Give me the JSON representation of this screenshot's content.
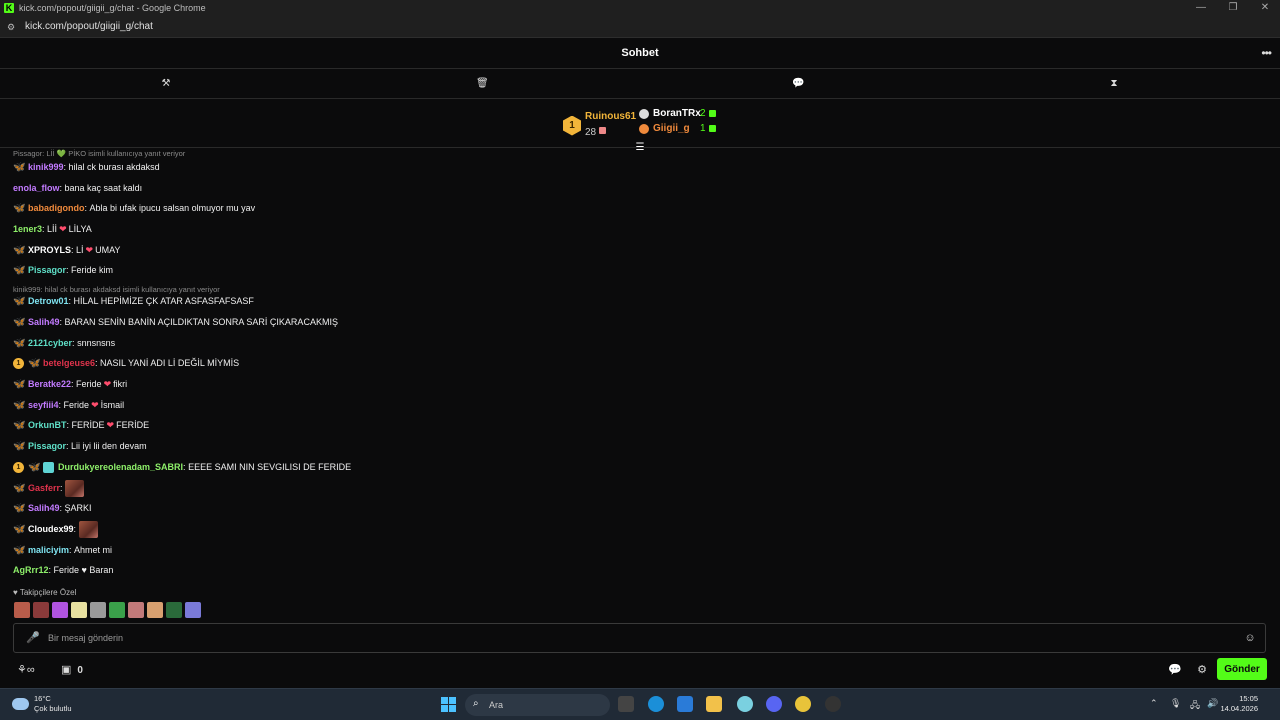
{
  "window": {
    "title": "kick.com/popout/giigii_g/chat - Google Chrome",
    "url": "kick.com/popout/giigii_g/chat"
  },
  "header": {
    "title": "Sohbet"
  },
  "leaderboard": {
    "first": {
      "rank": "1",
      "name": "Ruinous61",
      "count": "28"
    },
    "others": [
      {
        "name": "BoranTRx",
        "count": "2",
        "color": "#ffffff"
      },
      {
        "name": "Giigii_g",
        "count": "1",
        "color": "#f08a3c"
      }
    ]
  },
  "replies": [
    "Pissagor: Lİİ 💚 PİKO isimli kullanıcıya yanıt veriyor",
    "kinik999: hilal ck burası akdaksd isimli kullanıcıya yanıt veriyor"
  ],
  "messages": [
    {
      "user": "kinik999",
      "color": "#c27bff",
      "text": "hilal ck burası akdaksd"
    },
    {
      "user": "enola_flow",
      "color": "#c27bff",
      "text": "bana kaç saat kaldı"
    },
    {
      "user": "babadigondo",
      "color": "#f08a3c",
      "text": "Abla bi ufak ipucu salsan olmuyor mu yav"
    },
    {
      "user": "1ener3",
      "color": "#8ef06a",
      "text_a": "Lİİ",
      "text_b": "LİLYA"
    },
    {
      "user": "XPROYLS",
      "color": "#ffffff",
      "text_a": "Lİ",
      "text_b": "UMAY"
    },
    {
      "user": "Pissagor",
      "color": "#5fe0c8",
      "text": "Feride kim"
    },
    {
      "user": "Detrow01",
      "color": "#7fe3f0",
      "text": "HİLAL HEPİMİZE ÇK ATAR ASFASFAFSASF"
    },
    {
      "user": "Salih49",
      "color": "#c27bff",
      "text": "BARAN SENİN BANİN AÇILDIKTAN SONRA SARİ ÇIKARACAKMIŞ"
    },
    {
      "user": "2121cyber",
      "color": "#5fe0c8",
      "text": "snnsnsns"
    },
    {
      "user": "betelgeuse6",
      "color": "#e0334c",
      "text": "NASIL YANİ ADI Lİ DEĞİL MİYMİS"
    },
    {
      "user": "Beratke22",
      "color": "#c27bff",
      "text_a": "Feride",
      "text_b": "fikri"
    },
    {
      "user": "seyfiii4",
      "color": "#c27bff",
      "text_a": "Feride",
      "text_b": "İsmail"
    },
    {
      "user": "OrkunBT",
      "color": "#5fe0c8",
      "text_a": "FERİDE",
      "text_b": "FERİDE"
    },
    {
      "user": "Pissagor",
      "color": "#5fe0c8",
      "text": "Lii iyi lii den devam"
    },
    {
      "user": "Durdukyereolenadam_SABRI",
      "color": "#8ef06a",
      "text": "EEEE SAMI NIN SEVGILISI DE FERIDE"
    },
    {
      "user": "Gasferr",
      "color": "#e0334c",
      "text": ""
    },
    {
      "user": "Salih49",
      "color": "#c27bff",
      "text": "ŞARKI"
    },
    {
      "user": "Cloudex99",
      "color": "#ffffff",
      "text": ""
    },
    {
      "user": "maliciyim",
      "color": "#7fe3f0",
      "text": "Ahmet mi"
    },
    {
      "user": "AgRrr12",
      "color": "#8ef06a",
      "text": "Feride ♥ Baran"
    }
  ],
  "emotes": {
    "label": "Takipçilere Özel",
    "colors": [
      "#b85c4a",
      "#8a3a3a",
      "#b054e0",
      "#e8e0a0",
      "#9a9a9a",
      "#3aa04a",
      "#c27a7a",
      "#d8a070",
      "#2a6a3a",
      "#7a7ad8"
    ]
  },
  "input": {
    "placeholder": "Bir mesaj gönderin"
  },
  "bottom": {
    "points": "0",
    "send_label": "Gönder"
  },
  "taskbar": {
    "temp": "16°C",
    "weather": "Çok bulutlu",
    "search_label": "Ara",
    "time": "15:05",
    "date": "14.04.2026"
  },
  "colors": {
    "accent": "#53fc18",
    "gold": "#f2b53a"
  }
}
